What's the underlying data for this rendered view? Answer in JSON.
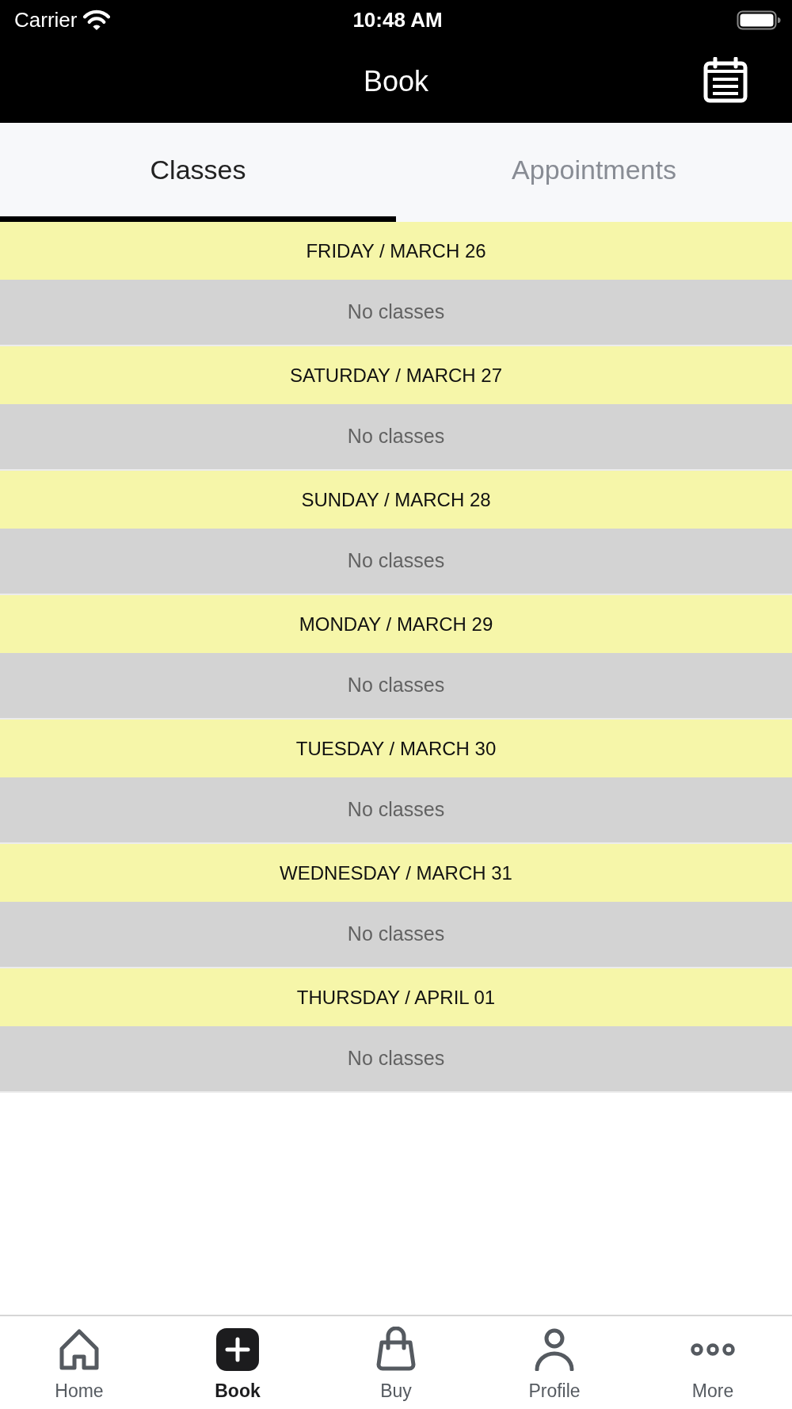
{
  "status_bar": {
    "carrier": "Carrier",
    "time": "10:48 AM"
  },
  "header": {
    "title": "Book"
  },
  "tabs": [
    {
      "label": "Classes",
      "selected": true
    },
    {
      "label": "Appointments",
      "selected": false
    }
  ],
  "days": [
    {
      "date": "FRIDAY / MARCH 26",
      "message": "No classes"
    },
    {
      "date": "SATURDAY / MARCH 27",
      "message": "No classes"
    },
    {
      "date": "SUNDAY / MARCH 28",
      "message": "No classes"
    },
    {
      "date": "MONDAY / MARCH 29",
      "message": "No classes"
    },
    {
      "date": "TUESDAY / MARCH 30",
      "message": "No classes"
    },
    {
      "date": "WEDNESDAY / MARCH 31",
      "message": "No classes"
    },
    {
      "date": "THURSDAY / APRIL 01",
      "message": "No classes"
    }
  ],
  "tab_bar": [
    {
      "kind": "home",
      "label": "Home",
      "selected": false
    },
    {
      "kind": "book",
      "label": "Book",
      "selected": true
    },
    {
      "kind": "buy",
      "label": "Buy",
      "selected": false
    },
    {
      "kind": "profile",
      "label": "Profile",
      "selected": false
    },
    {
      "kind": "more",
      "label": "More",
      "selected": false
    }
  ]
}
